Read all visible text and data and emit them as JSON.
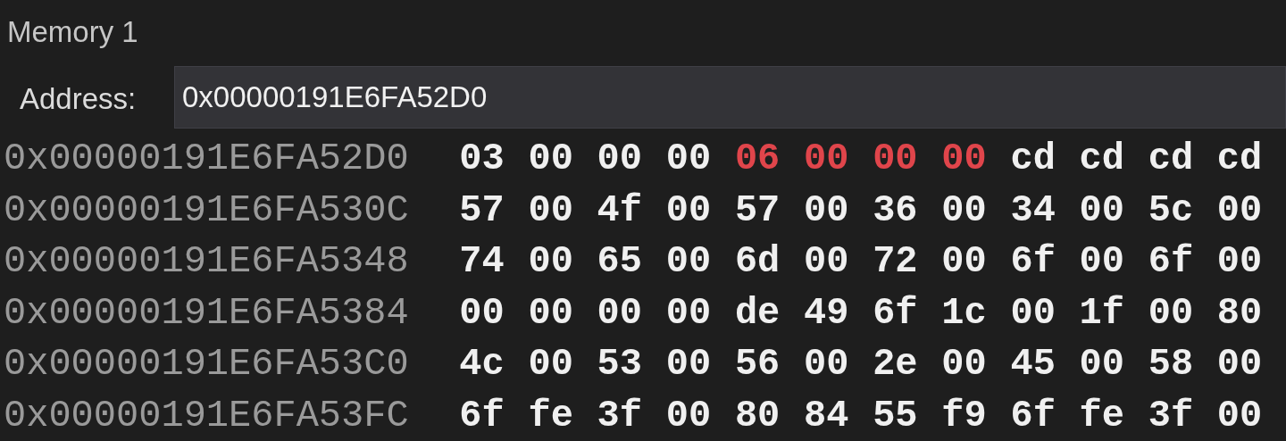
{
  "window": {
    "title": "Memory 1"
  },
  "address_bar": {
    "label": "Address:",
    "value": "0x00000191E6FA52D0"
  },
  "rows": [
    {
      "address": "0x00000191E6FA52D0",
      "bytes": [
        {
          "value": "03",
          "changed": false
        },
        {
          "value": "00",
          "changed": false
        },
        {
          "value": "00",
          "changed": false
        },
        {
          "value": "00",
          "changed": false
        },
        {
          "value": "06",
          "changed": true
        },
        {
          "value": "00",
          "changed": true
        },
        {
          "value": "00",
          "changed": true
        },
        {
          "value": "00",
          "changed": true
        },
        {
          "value": "cd",
          "changed": false
        },
        {
          "value": "cd",
          "changed": false
        },
        {
          "value": "cd",
          "changed": false
        },
        {
          "value": "cd",
          "changed": false
        }
      ]
    },
    {
      "address": "0x00000191E6FA530C",
      "bytes": [
        {
          "value": "57",
          "changed": false
        },
        {
          "value": "00",
          "changed": false
        },
        {
          "value": "4f",
          "changed": false
        },
        {
          "value": "00",
          "changed": false
        },
        {
          "value": "57",
          "changed": false
        },
        {
          "value": "00",
          "changed": false
        },
        {
          "value": "36",
          "changed": false
        },
        {
          "value": "00",
          "changed": false
        },
        {
          "value": "34",
          "changed": false
        },
        {
          "value": "00",
          "changed": false
        },
        {
          "value": "5c",
          "changed": false
        },
        {
          "value": "00",
          "changed": false
        }
      ]
    },
    {
      "address": "0x00000191E6FA5348",
      "bytes": [
        {
          "value": "74",
          "changed": false
        },
        {
          "value": "00",
          "changed": false
        },
        {
          "value": "65",
          "changed": false
        },
        {
          "value": "00",
          "changed": false
        },
        {
          "value": "6d",
          "changed": false
        },
        {
          "value": "00",
          "changed": false
        },
        {
          "value": "72",
          "changed": false
        },
        {
          "value": "00",
          "changed": false
        },
        {
          "value": "6f",
          "changed": false
        },
        {
          "value": "00",
          "changed": false
        },
        {
          "value": "6f",
          "changed": false
        },
        {
          "value": "00",
          "changed": false
        }
      ]
    },
    {
      "address": "0x00000191E6FA5384",
      "bytes": [
        {
          "value": "00",
          "changed": false
        },
        {
          "value": "00",
          "changed": false
        },
        {
          "value": "00",
          "changed": false
        },
        {
          "value": "00",
          "changed": false
        },
        {
          "value": "de",
          "changed": false
        },
        {
          "value": "49",
          "changed": false
        },
        {
          "value": "6f",
          "changed": false
        },
        {
          "value": "1c",
          "changed": false
        },
        {
          "value": "00",
          "changed": false
        },
        {
          "value": "1f",
          "changed": false
        },
        {
          "value": "00",
          "changed": false
        },
        {
          "value": "80",
          "changed": false
        }
      ]
    },
    {
      "address": "0x00000191E6FA53C0",
      "bytes": [
        {
          "value": "4c",
          "changed": false
        },
        {
          "value": "00",
          "changed": false
        },
        {
          "value": "53",
          "changed": false
        },
        {
          "value": "00",
          "changed": false
        },
        {
          "value": "56",
          "changed": false
        },
        {
          "value": "00",
          "changed": false
        },
        {
          "value": "2e",
          "changed": false
        },
        {
          "value": "00",
          "changed": false
        },
        {
          "value": "45",
          "changed": false
        },
        {
          "value": "00",
          "changed": false
        },
        {
          "value": "58",
          "changed": false
        },
        {
          "value": "00",
          "changed": false
        }
      ]
    },
    {
      "address": "0x00000191E6FA53FC",
      "bytes": [
        {
          "value": "6f",
          "changed": false
        },
        {
          "value": "fe",
          "changed": false
        },
        {
          "value": "3f",
          "changed": false
        },
        {
          "value": "00",
          "changed": false
        },
        {
          "value": "80",
          "changed": false
        },
        {
          "value": "84",
          "changed": false
        },
        {
          "value": "55",
          "changed": false
        },
        {
          "value": "f9",
          "changed": false
        },
        {
          "value": "6f",
          "changed": false
        },
        {
          "value": "fe",
          "changed": false
        },
        {
          "value": "3f",
          "changed": false
        },
        {
          "value": "00",
          "changed": false
        }
      ]
    }
  ]
}
